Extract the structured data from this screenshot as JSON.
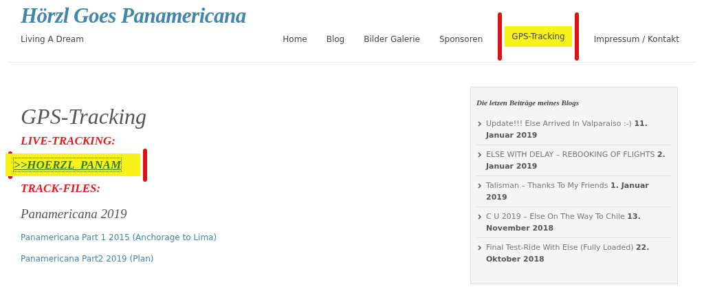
{
  "site": {
    "title": "Hörzl Goes Panamericana",
    "tagline": "Living A Dream"
  },
  "nav": [
    {
      "label": "Home",
      "highlighted": false
    },
    {
      "label": "Blog",
      "highlighted": false
    },
    {
      "label": "Bilder Galerie",
      "highlighted": false
    },
    {
      "label": "Sponsoren",
      "highlighted": false
    },
    {
      "label": "GPS-Tracking",
      "highlighted": true
    },
    {
      "label": "Impressum / Kontakt",
      "highlighted": false
    }
  ],
  "page": {
    "title": "GPS-Tracking",
    "blocks": [
      {
        "kind": "heading",
        "text": "LIVE-TRACKING:"
      },
      {
        "kind": "tracklink",
        "text": ">>HOERZL_PANAM",
        "highlighted": true
      },
      {
        "kind": "heading",
        "text": "TRACK-FILES:"
      },
      {
        "kind": "subheading",
        "text": "Panamericana 2019"
      },
      {
        "kind": "link",
        "text": "Panamericana Part 1 2015 (Anchorage to Lima)"
      },
      {
        "kind": "link",
        "text": "Panamericana Part2 2019 (Plan)"
      }
    ]
  },
  "sidebar": {
    "title": "Die letzen Beiträge meines Blogs",
    "posts": [
      {
        "title": "Update!!! Else Arrived In Valparaiso :-)",
        "date": "11. Januar 2019"
      },
      {
        "title": "ELSE WITH DELAY – REBOOKING OF FLIGHTS",
        "date": "2. Januar 2019"
      },
      {
        "title": "Talisman – Thanks To My Friends",
        "date": "1. Januar 2019"
      },
      {
        "title": "C U 2019 – Else On The Way To Chile",
        "date": "13. November 2018"
      },
      {
        "title": "Final Test-Ride With Else (Fully Loaded)",
        "date": "22. Oktober 2018"
      }
    ]
  }
}
